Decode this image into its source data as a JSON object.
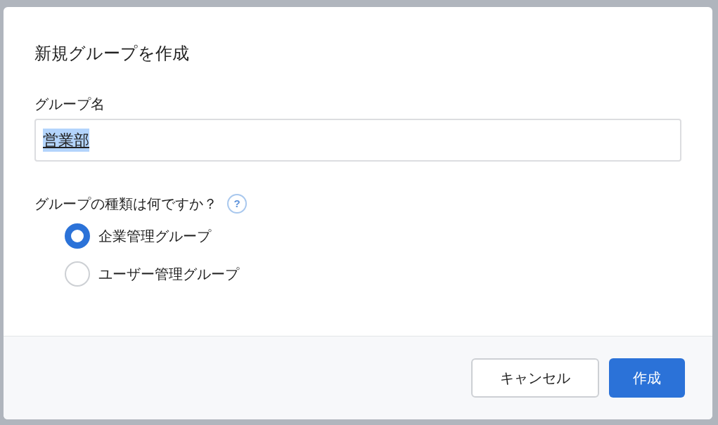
{
  "dialog": {
    "title": "新規グループを作成",
    "name_field": {
      "label": "グループ名",
      "value": "営業部",
      "text_selected": true
    },
    "type_question": {
      "label": "グループの種類は何ですか？",
      "help_icon": "?"
    },
    "options": [
      {
        "label": "企業管理グループ",
        "selected": true
      },
      {
        "label": "ユーザー管理グループ",
        "selected": false
      }
    ],
    "buttons": [
      {
        "label": "キャンセル",
        "kind": "secondary"
      },
      {
        "label": "作成",
        "kind": "primary"
      }
    ]
  }
}
